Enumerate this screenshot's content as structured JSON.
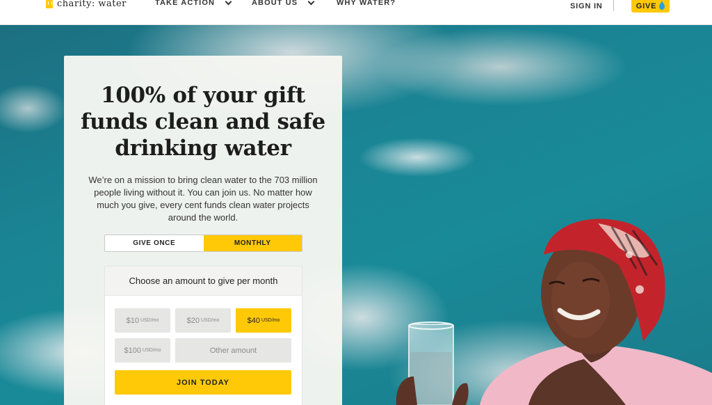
{
  "nav": {
    "logo_text": "charity: water",
    "take_action": "TAKE ACTION",
    "about_us": "ABOUT US",
    "why_water": "WHY WATER?",
    "sign_in": "SIGN IN",
    "give": "GIVE"
  },
  "card": {
    "headline_lines": [
      "100% of your gift",
      "funds clean and safe",
      "drinking water"
    ],
    "blurb": "We’re on a mission to bring clean water to the 703 million people living without it. You can join us. No matter how much you give, every cent funds clean water projects around the world.",
    "give_once": "GIVE ONCE",
    "monthly": "MONTHLY",
    "selected_frequency": "MONTHLY",
    "amount_title": "Choose an amount to give per month",
    "amounts": [
      {
        "value": "$10",
        "unit": "USD/mo",
        "selected": false
      },
      {
        "value": "$20",
        "unit": "USD/mo",
        "selected": false
      },
      {
        "value": "$40",
        "unit": "USD/mo",
        "selected": true
      },
      {
        "value": "$100",
        "unit": "USD/mo",
        "selected": false
      }
    ],
    "other_amount": "Other amount",
    "join": "JOIN TODAY"
  },
  "colors": {
    "accent": "#ffc907",
    "sky": "#1a8494",
    "card_bg": "#f6f6f2"
  },
  "icons": {
    "logo": "jerrycan-logo-icon",
    "give": "water-drop-icon",
    "dropdown": "chevron-down-icon"
  }
}
